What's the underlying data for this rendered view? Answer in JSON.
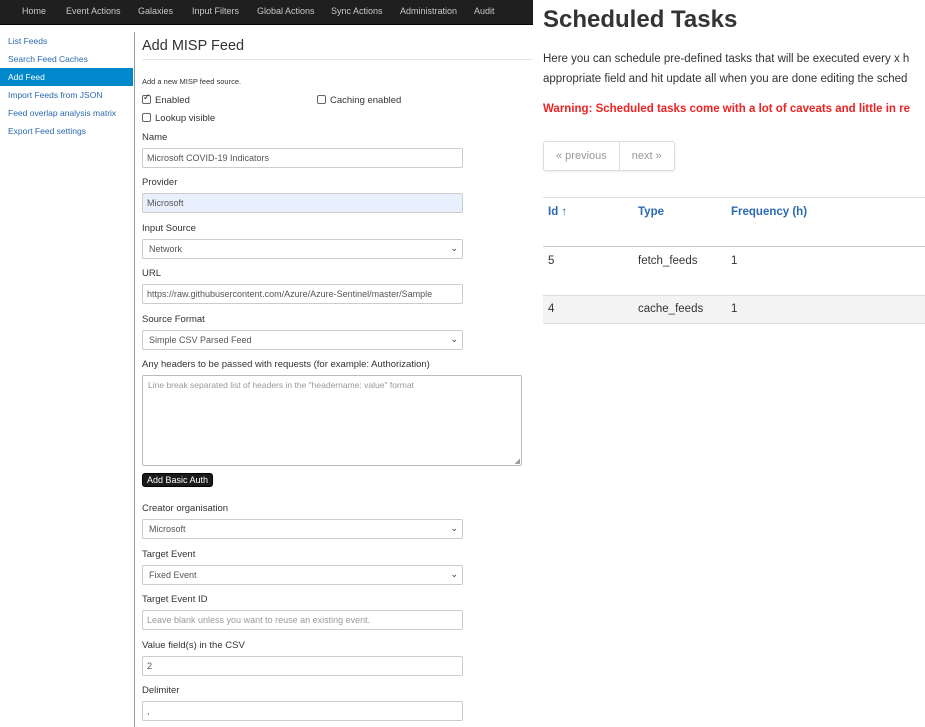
{
  "topnav": {
    "items": [
      "Home",
      "Event Actions",
      "Galaxies",
      "Input Filters",
      "Global Actions",
      "Sync Actions",
      "Administration",
      "Audit"
    ]
  },
  "sidebar": {
    "items": [
      {
        "label": "List Feeds",
        "active": false
      },
      {
        "label": "Search Feed Caches",
        "active": false
      },
      {
        "label": "Add Feed",
        "active": true
      },
      {
        "label": "Import Feeds from JSON",
        "active": false
      },
      {
        "label": "Feed overlap analysis matrix",
        "active": false
      },
      {
        "label": "Export Feed settings",
        "active": false
      }
    ]
  },
  "form": {
    "title": "Add MISP Feed",
    "subtitle": "Add a new MISP feed source.",
    "enabled_label": "Enabled",
    "caching_label": "Caching enabled",
    "lookup_label": "Lookup visible",
    "name_label": "Name",
    "name_value": "Microsoft COVID-19 Indicators",
    "provider_label": "Provider",
    "provider_value": "Microsoft",
    "input_source_label": "Input Source",
    "input_source_value": "Network",
    "url_label": "URL",
    "url_value": "https://raw.githubusercontent.com/Azure/Azure-Sentinel/master/Sample",
    "source_format_label": "Source Format",
    "source_format_value": "Simple CSV Parsed Feed",
    "headers_label": "Any headers to be passed with requests (for example: Authorization)",
    "headers_placeholder": "Line break separated list of headers in the \"headername: value\" format",
    "basic_auth_label": "Add Basic Auth",
    "creator_org_label": "Creator organisation",
    "creator_org_value": "Microsoft",
    "target_event_label": "Target Event",
    "target_event_value": "Fixed Event",
    "target_event_id_label": "Target Event ID",
    "target_event_id_placeholder": "Leave blank unless you want to reuse an existing event.",
    "value_fields_label": "Value field(s) in the CSV",
    "value_fields_value": "2",
    "delimiter_label": "Delimiter",
    "delimiter_value": ","
  },
  "scheduled": {
    "title": "Scheduled Tasks",
    "desc_line1": "Here you can schedule pre-defined tasks that will be executed every x h",
    "desc_line2": "appropriate field and hit update all when you are done editing the sched",
    "warning": "Warning: Scheduled tasks come with a lot of caveats and little in re",
    "prev_label": "« previous",
    "next_label": "next »",
    "columns": [
      "Id ↑",
      "Type",
      "Frequency (h)"
    ],
    "rows": [
      {
        "id": "5",
        "type": "fetch_feeds",
        "frequency": "1"
      },
      {
        "id": "4",
        "type": "cache_feeds",
        "frequency": "1"
      }
    ]
  }
}
